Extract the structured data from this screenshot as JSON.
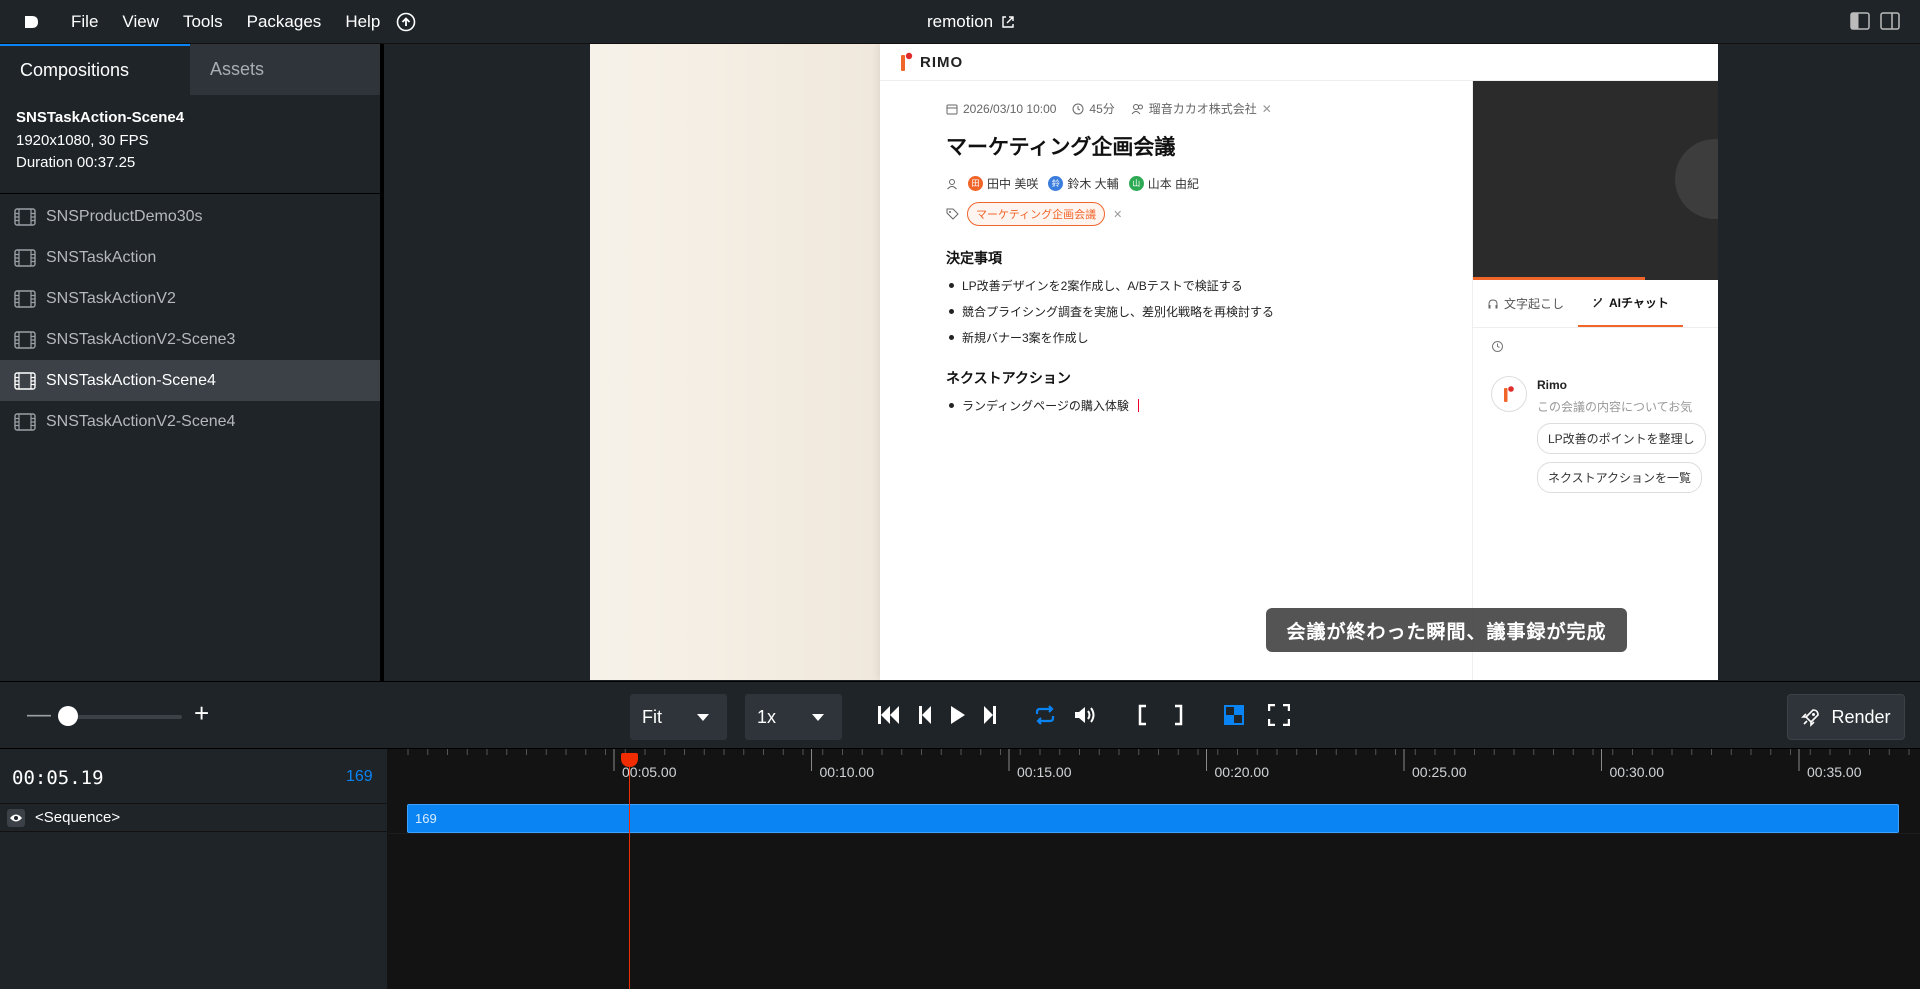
{
  "menubar": {
    "items": [
      "File",
      "View",
      "Tools",
      "Packages",
      "Help"
    ],
    "title": "remotion"
  },
  "sidebar": {
    "tabs": [
      "Compositions",
      "Assets"
    ],
    "composition": {
      "name": "SNSTaskAction-Scene4",
      "resolution": "1920x1080, 30 FPS",
      "duration": "Duration 00:37.25"
    },
    "items": [
      {
        "label": "SNSProductDemo30s"
      },
      {
        "label": "SNSTaskAction"
      },
      {
        "label": "SNSTaskActionV2"
      },
      {
        "label": "SNSTaskActionV2-Scene3"
      },
      {
        "label": "SNSTaskAction-Scene4"
      },
      {
        "label": "SNSTaskActionV2-Scene4"
      }
    ]
  },
  "preview": {
    "brand": "RIMO",
    "date": "2026/03/10 10:00",
    "length": "45分",
    "company": "瑠音カカオ株式会社",
    "meeting_title": "マーケティング企画会議",
    "people": [
      {
        "initial": "田",
        "name": "田中 美咲",
        "color": "#f0652a"
      },
      {
        "initial": "鈴",
        "name": "鈴木 大輔",
        "color": "#3b7ddd"
      },
      {
        "initial": "山",
        "name": "山本 由紀",
        "color": "#2eaa55"
      }
    ],
    "tag": "マーケティング企画会議",
    "decisions_title": "決定事項",
    "decisions": [
      "LP改善デザインを2案作成し、A/Bテストで検証する",
      "競合プライシング調査を実施し、差別化戦略を再検討する",
      "新規バナー3案を作成し"
    ],
    "actions_title": "ネクストアクション",
    "actions": [
      "ランディングページの購入体験"
    ],
    "panel_tabs": [
      "文字起こし",
      "AIチャット"
    ],
    "chat_name": "Rimo",
    "chat_text": "この会議の内容についてお気",
    "chips": [
      "LP改善のポイントを整理し",
      "ネクストアクションを一覧"
    ],
    "subtitle": "会議が終わった瞬間、議事録が完成"
  },
  "controls": {
    "zoom_select": "Fit",
    "speed_select": "1x",
    "render_label": "Render"
  },
  "timeline": {
    "current_time": "00:05.19",
    "frame": "169",
    "track_label": "<Sequence>",
    "sequence_label": "169",
    "ticks": [
      "00:05.00",
      "00:10.00",
      "00:15.00",
      "00:20.00",
      "00:25.00",
      "00:30.00",
      "00:35.00"
    ]
  },
  "colors": {
    "accent": "#0b84f3",
    "playhead": "#f02c00",
    "brand_orange": "#f0652a"
  }
}
